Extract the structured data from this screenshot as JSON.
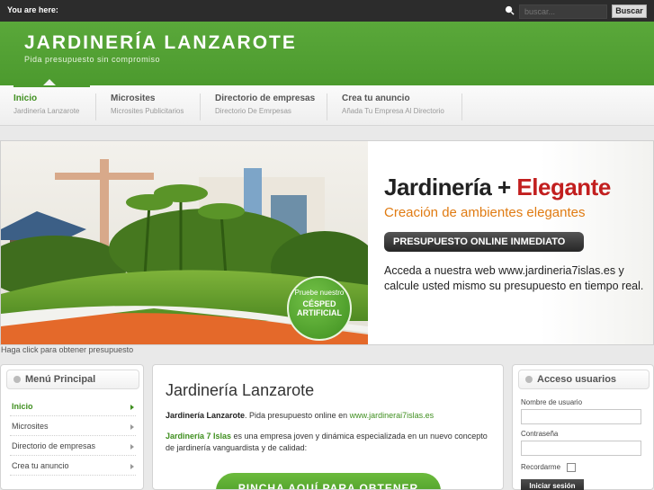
{
  "topbar": {
    "breadcrumb_label": "You are here:",
    "search_placeholder": "buscar...",
    "search_button": "Buscar"
  },
  "header": {
    "title": "JARDINERÍA LANZAROTE",
    "subtitle": "Pida presupuesto sin compromiso"
  },
  "nav": {
    "items": [
      {
        "label": "Inicio",
        "sub": "Jardinería Lanzarote"
      },
      {
        "label": "Microsites",
        "sub": "Microsites Publicitarios"
      },
      {
        "label": "Directorio de empresas",
        "sub": "Directorio De Emrpesas"
      },
      {
        "label": "Crea tu anuncio",
        "sub": "Añada Tu Empresa Al Directorio"
      }
    ]
  },
  "banner": {
    "headline_part1": "Jardinería + ",
    "headline_part2": "Elegante",
    "tagline": "Creación de ambientes elegantes",
    "pill": "PRESUPUESTO ONLINE INMEDIATO",
    "description": "Acceda a nuestra web www.jardineria7islas.es y calcule usted mismo su presupuesto en tiempo real.",
    "badge_line1": "Pruebe nuestro",
    "badge_line2": "CÉSPED ARTIFICIAL",
    "caption": "Haga click para obtener presupuesto"
  },
  "left_menu": {
    "title": "Menú Principal",
    "items": [
      "Inicio",
      "Microsites",
      "Directorio de empresas",
      "Crea tu anuncio"
    ]
  },
  "content": {
    "title": "Jardinería Lanzarote",
    "p1_bold": "Jardinería Lanzarote",
    "p1_text": ". Pida presupuesto online en ",
    "p1_link": "www.jardinerai7islas.es",
    "p2_link": "Jardinería 7 Islas",
    "p2_text": " es una empresa joven y dinámica especializada en un nuevo concepto de jardinería vanguardista y de calidad:",
    "cta": "PINCHA AQUÍ PARA OBTENER"
  },
  "login": {
    "title": "Acceso usuarios",
    "username_label": "Nombre de usuario",
    "password_label": "Contraseña",
    "remember_label": "Recordarme",
    "submit": "Iniciar sesión"
  },
  "colors": {
    "brand_green": "#4c9a2e",
    "accent_red": "#c21f1f",
    "accent_orange": "#e07b12"
  }
}
